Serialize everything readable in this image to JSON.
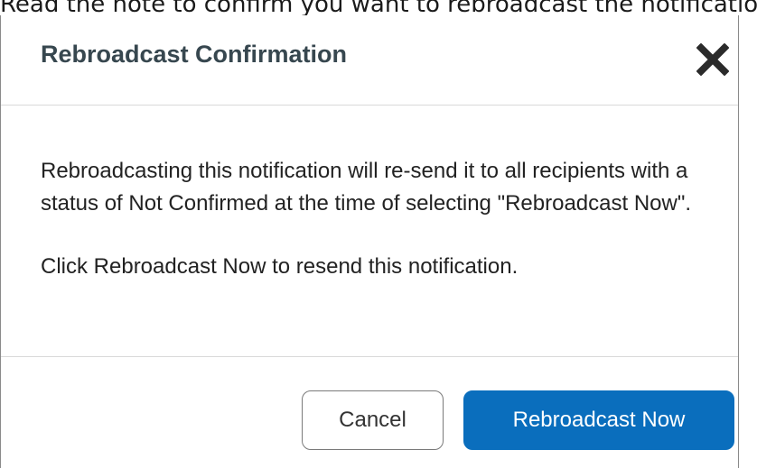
{
  "instruction": {
    "text": "Read the note to confirm you want to rebroadcast the notification."
  },
  "dialog": {
    "title": "Rebroadcast Confirmation",
    "close_icon": "close-icon",
    "body": {
      "paragraph_1": "Rebroadcasting this notification will re-send it to all recipients with a status of Not Confirmed at the time of selecting \"Rebroadcast Now\".",
      "paragraph_2": "Click Rebroadcast Now to resend this notification."
    },
    "buttons": {
      "cancel_label": "Cancel",
      "primary_label": "Rebroadcast Now"
    }
  },
  "colors": {
    "title": "#37474f",
    "primary_button": "#0a6ebd",
    "close_icon": "#2b2b2b",
    "divider": "#d9d9d9"
  }
}
